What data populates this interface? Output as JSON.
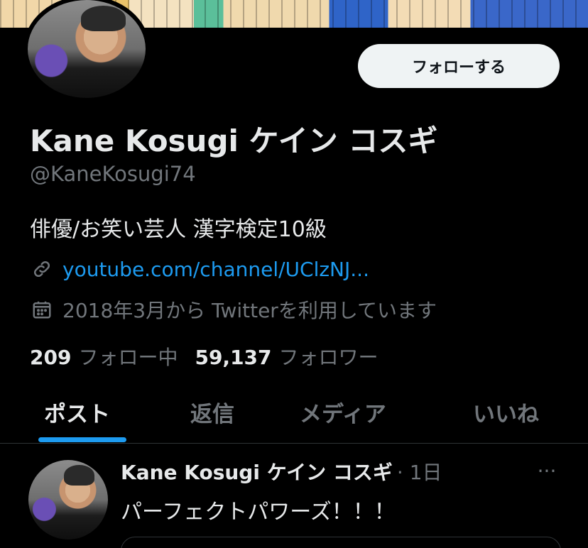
{
  "profile": {
    "name": "Kane Kosugi ケイン コスギ",
    "handle": "@KaneKosugi74",
    "bio": "俳優/お笑い芸人 漢字検定10級",
    "link": "youtube.com/channel/UClzNJ...",
    "joined": "2018年3月から Twitterを利用しています",
    "follow_label": "フォローする"
  },
  "stats": {
    "following_count": "209",
    "following_label": "フォロー中",
    "followers_count": "59,137",
    "followers_label": "フォロワー"
  },
  "tabs": [
    {
      "label": "ポスト",
      "active": true
    },
    {
      "label": "返信",
      "active": false
    },
    {
      "label": "メディア",
      "active": false
    },
    {
      "label": "いいね",
      "active": false
    }
  ],
  "post": {
    "author": "Kane Kosugi ケイン コスギ",
    "time": "· 1日",
    "text": "パーフェクトパワーズ！！！",
    "more": "···"
  },
  "colors": {
    "accent": "#1d9bf0",
    "background": "#000000",
    "text": "#e7e9ea",
    "muted": "#71767b"
  },
  "icons": {
    "link": "link-icon",
    "calendar": "calendar-icon",
    "more": "more-icon"
  }
}
